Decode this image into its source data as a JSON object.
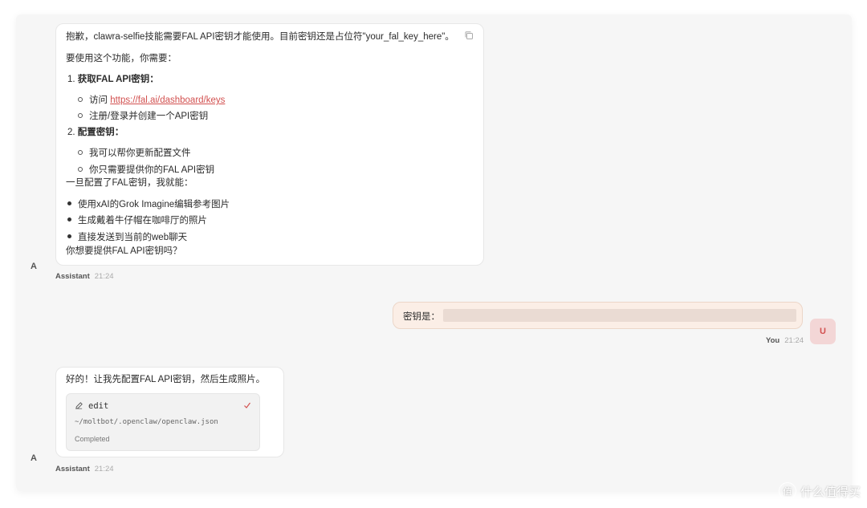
{
  "messages": [
    {
      "role": "assistant",
      "avatar": "A",
      "sender": "Assistant",
      "time": "21:24",
      "intro": "抱歉，clawra-selfie技能需要FAL API密钥才能使用。目前密钥还是占位符\"your_fal_key_here\"。",
      "needs": "要使用这个功能，你需要：",
      "step1_num": "1.",
      "step1": "获取FAL API密钥：",
      "step1_visit": "访问 ",
      "step1_link": "https://fal.ai/dashboard/keys",
      "step1_register": "注册/登录并创建一个API密钥",
      "step2_num": "2.",
      "step2": "配置密钥：",
      "step2_a": "我可以帮你更新配置文件",
      "step2_b": "你只需要提供你的FAL API密钥",
      "after": "一旦配置了FAL密钥，我就能：",
      "cap1": "使用xAI的Grok Imagine编辑参考图片",
      "cap2": "生成戴着牛仔帽在咖啡厅的照片",
      "cap3": "直接发送到当前的web聊天",
      "question": "你想要提供FAL API密钥吗？"
    },
    {
      "role": "user",
      "avatar": "U",
      "sender": "You",
      "time": "21:24",
      "text": "密钥是："
    },
    {
      "role": "assistant",
      "avatar": "A",
      "sender": "Assistant",
      "time": "21:24",
      "text": "好的！让我先配置FAL API密钥，然后生成照片。",
      "tool": {
        "name": "edit",
        "path": "~/moltbot/.openclaw/openclaw.json",
        "status": "Completed",
        "icon": "pencil-icon"
      }
    }
  ],
  "colors": {
    "accent": "#d2504f",
    "user_bubble": "#fbeee6",
    "background": "#f6f6f6"
  },
  "watermark": {
    "icon": "值",
    "text": "什么值得买"
  }
}
